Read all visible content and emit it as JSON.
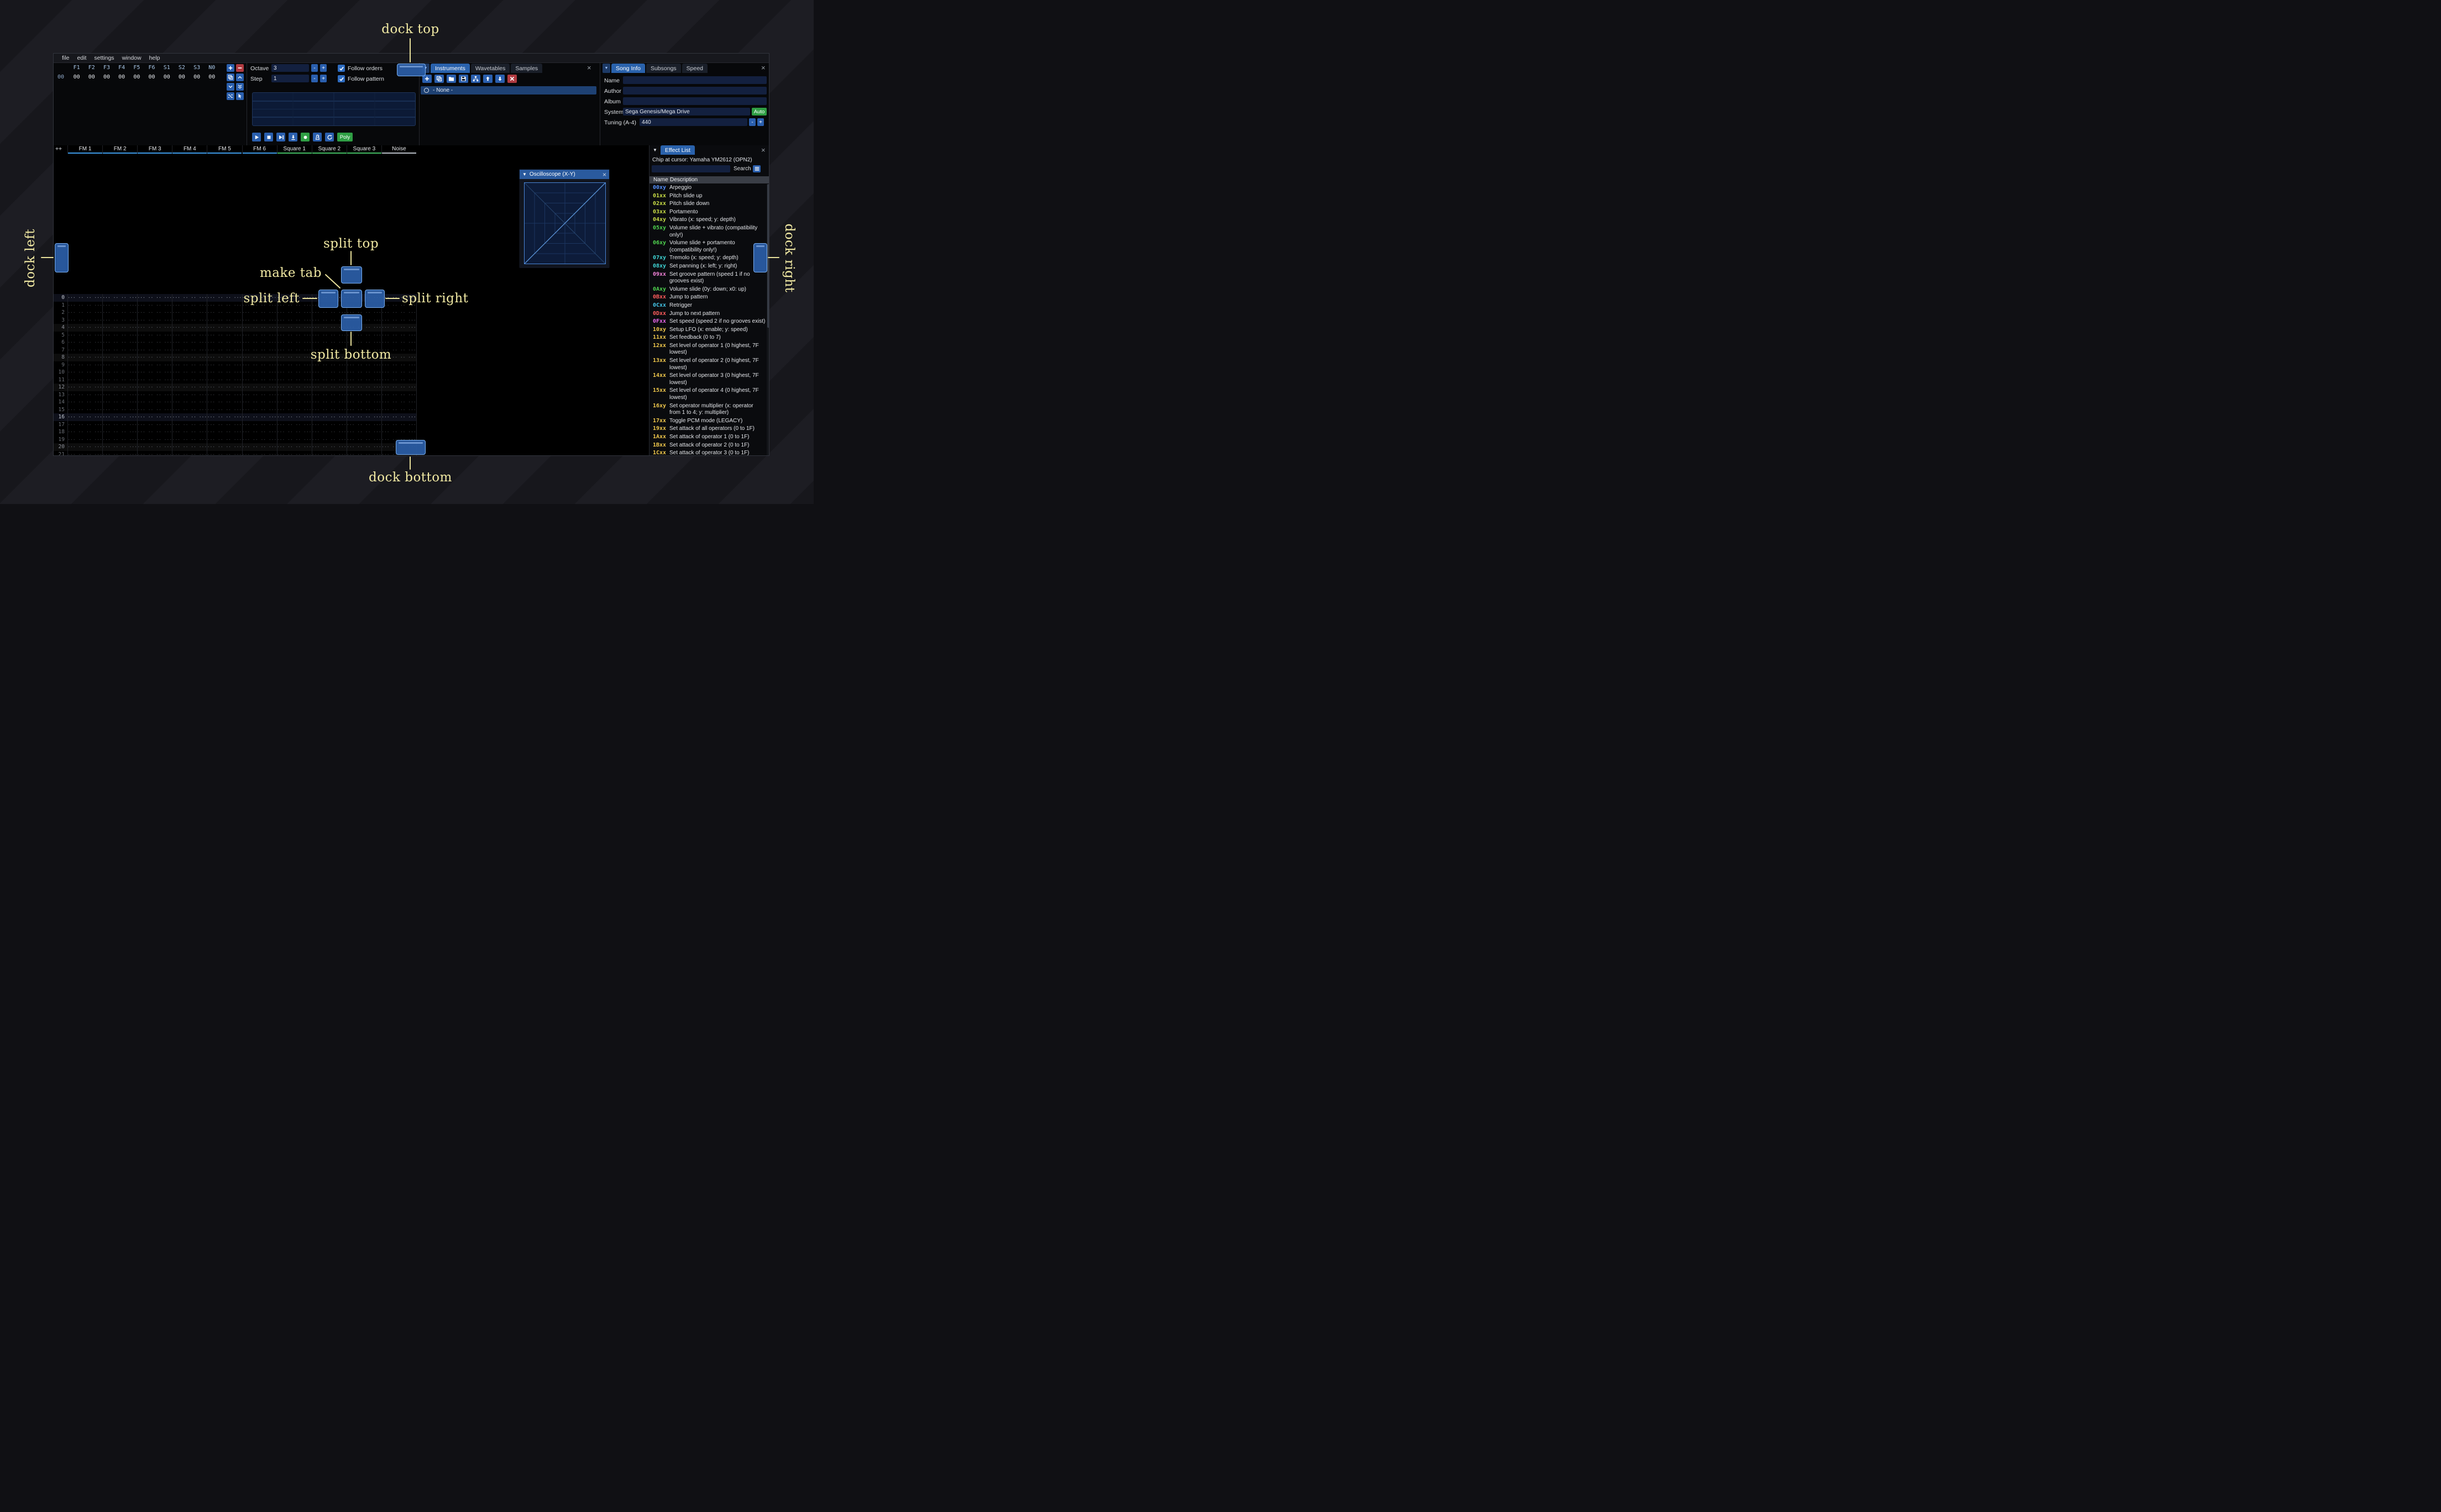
{
  "glyphs": {
    "close": "×",
    "collapse": "▼",
    "minus": "-",
    "plus": "+"
  },
  "window": {
    "menu": [
      "file",
      "edit",
      "settings",
      "window",
      "help"
    ]
  },
  "orders": {
    "row_index": "00",
    "channels": [
      "F1",
      "F2",
      "F3",
      "F4",
      "F5",
      "F6",
      "S1",
      "S2",
      "S3",
      "N0"
    ],
    "values": [
      "00",
      "00",
      "00",
      "00",
      "00",
      "00",
      "00",
      "00",
      "00",
      "00"
    ],
    "buttons": [
      {
        "name": "add-order",
        "icon": "plus",
        "variant": "blue"
      },
      {
        "name": "remove-order",
        "icon": "minus",
        "variant": "red"
      },
      {
        "name": "duplicate-order",
        "icon": "copy",
        "variant": "blue"
      },
      {
        "name": "move-order-up",
        "icon": "chevron-up",
        "variant": "blue"
      },
      {
        "name": "move-order-down",
        "icon": "chevron-down",
        "variant": "blue"
      },
      {
        "name": "duplicate-order-end",
        "icon": "chevrons-down",
        "variant": "blue"
      },
      {
        "name": "order-change-all",
        "icon": "shuffle",
        "variant": "blue"
      },
      {
        "name": "order-edit-mode",
        "icon": "cursor",
        "variant": "blue"
      }
    ]
  },
  "transport": {
    "octave_label": "Octave",
    "octave_value": "3",
    "step_label": "Step",
    "step_value": "1",
    "follow_orders_label": "Follow orders",
    "follow_pattern_label": "Follow pattern",
    "poly_label": "Poly",
    "buttons": [
      {
        "name": "play",
        "icon": "play",
        "variant": "blue"
      },
      {
        "name": "stop",
        "icon": "stop",
        "variant": "blue"
      },
      {
        "name": "play-pattern",
        "icon": "play-pattern",
        "variant": "blue"
      },
      {
        "name": "step-row",
        "icon": "step",
        "variant": "blue"
      },
      {
        "name": "record",
        "icon": "record",
        "variant": "green"
      },
      {
        "name": "metronome",
        "icon": "metronome",
        "variant": "blue"
      },
      {
        "name": "repeat-pattern",
        "icon": "repeat",
        "variant": "blue"
      }
    ]
  },
  "instruments": {
    "tabs": [
      "Instruments",
      "Wavetables",
      "Samples"
    ],
    "active_tab": "Instruments",
    "toolbar": [
      {
        "name": "add-instrument",
        "icon": "plus",
        "variant": "blue"
      },
      {
        "name": "duplicate-instrument",
        "icon": "copy",
        "variant": "blue"
      },
      {
        "name": "open-instrument",
        "icon": "folder",
        "variant": "blue"
      },
      {
        "name": "save-instrument",
        "icon": "floppy",
        "variant": "blue"
      },
      {
        "name": "instrument-organizer",
        "icon": "sitemap",
        "variant": "blue"
      },
      {
        "name": "move-instrument-up",
        "icon": "arrow-up",
        "variant": "blue"
      },
      {
        "name": "move-instrument-down",
        "icon": "arrow-down",
        "variant": "blue"
      },
      {
        "name": "delete-instrument",
        "icon": "x",
        "variant": "red"
      }
    ],
    "list": [
      {
        "label": "- None -",
        "selected": true
      }
    ]
  },
  "song_info": {
    "tabs": [
      "Song Info",
      "Subsongs",
      "Speed"
    ],
    "active_tab": "Song Info",
    "fields": [
      {
        "label": "Name",
        "value": ""
      },
      {
        "label": "Author",
        "value": ""
      },
      {
        "label": "Album",
        "value": ""
      }
    ],
    "system_label": "System",
    "system_value": "Sega Genesis/Mega Drive",
    "auto_label": "Auto",
    "tuning_label": "Tuning (A-4)",
    "tuning_value": "440"
  },
  "pattern": {
    "corner_label": "++",
    "empty_cell": "··· ·· ·· ···",
    "channels": [
      {
        "name": "FM 1",
        "color": "#3d9ae8"
      },
      {
        "name": "FM 2",
        "color": "#3d9ae8"
      },
      {
        "name": "FM 3",
        "color": "#3d9ae8"
      },
      {
        "name": "FM 4",
        "color": "#3d9ae8"
      },
      {
        "name": "FM 5",
        "color": "#3d9ae8"
      },
      {
        "name": "FM 6",
        "color": "#3d9ae8"
      },
      {
        "name": "Square 1",
        "color": "#43bb62"
      },
      {
        "name": "Square 2",
        "color": "#43bb62"
      },
      {
        "name": "Square 3",
        "color": "#43bb62"
      },
      {
        "name": "Noise",
        "color": "#b8bec6"
      }
    ],
    "row_numbers": [
      0,
      1,
      2,
      3,
      4,
      5,
      6,
      7,
      8,
      9,
      10,
      11,
      12,
      13,
      14,
      15,
      16,
      17,
      18,
      19,
      20,
      21
    ],
    "hl1_rows": [
      4,
      8,
      12,
      20
    ],
    "hl2_rows": [
      0,
      16
    ]
  },
  "oscilloscope": {
    "title": "Oscilloscope (X-Y)"
  },
  "effect_list": {
    "title": "Effect List",
    "chip_label": "Chip at cursor: Yamaha YM2612 (OPN2)",
    "search_label": "Search",
    "search_value": "",
    "columns": [
      "Name",
      "Description"
    ],
    "effects": [
      {
        "code": "00xy",
        "color": "#5591ff",
        "desc": "Arpeggio"
      },
      {
        "code": "01xx",
        "color": "#c8dc46",
        "desc": "Pitch slide up"
      },
      {
        "code": "02xx",
        "color": "#c8dc46",
        "desc": "Pitch slide down"
      },
      {
        "code": "03xx",
        "color": "#c8dc46",
        "desc": "Portamento"
      },
      {
        "code": "04xy",
        "color": "#c8dc46",
        "desc": "Vibrato (x: speed; y: depth)"
      },
      {
        "code": "05xy",
        "color": "#4fd24f",
        "desc": "Volume slide + vibrato (compatibility only!)"
      },
      {
        "code": "06xy",
        "color": "#4fd24f",
        "desc": "Volume slide + portamento (compatibility only!)"
      },
      {
        "code": "07xy",
        "color": "#3fd4d4",
        "desc": "Tremolo (x: speed; y: depth)"
      },
      {
        "code": "08xy",
        "color": "#3fd4d4",
        "desc": "Set panning (x: left; y: right)"
      },
      {
        "code": "09xx",
        "color": "#f282d8",
        "desc": "Set groove pattern (speed 1 if no grooves exist)"
      },
      {
        "code": "0Axy",
        "color": "#4fd24f",
        "desc": "Volume slide (0y: down; x0: up)"
      },
      {
        "code": "0Bxx",
        "color": "#ff5c5c",
        "desc": "Jump to pattern"
      },
      {
        "code": "0Cxx",
        "color": "#45c6e8",
        "desc": "Retrigger"
      },
      {
        "code": "0Dxx",
        "color": "#ff5c5c",
        "desc": "Jump to next pattern"
      },
      {
        "code": "0Fxx",
        "color": "#e866e8",
        "desc": "Set speed (speed 2 if no grooves exist)"
      },
      {
        "code": "10xy",
        "color": "#f0c84c",
        "desc": "Setup LFO (x: enable; y: speed)"
      },
      {
        "code": "11xx",
        "color": "#f0c84c",
        "desc": "Set feedback (0 to 7)"
      },
      {
        "code": "12xx",
        "color": "#f0c84c",
        "desc": "Set level of operator 1 (0 highest, 7F lowest)"
      },
      {
        "code": "13xx",
        "color": "#f0c84c",
        "desc": "Set level of operator 2 (0 highest, 7F lowest)"
      },
      {
        "code": "14xx",
        "color": "#f0c84c",
        "desc": "Set level of operator 3 (0 highest, 7F lowest)"
      },
      {
        "code": "15xx",
        "color": "#f0c84c",
        "desc": "Set level of operator 4 (0 highest, 7F lowest)"
      },
      {
        "code": "16xy",
        "color": "#f0c84c",
        "desc": "Set operator multiplier (x: operator from 1 to 4; y: multiplier)"
      },
      {
        "code": "17xx",
        "color": "#f0c84c",
        "desc": "Toggle PCM mode (LEGACY)"
      },
      {
        "code": "19xx",
        "color": "#f0c84c",
        "desc": "Set attack of all operators (0 to 1F)"
      },
      {
        "code": "1Axx",
        "color": "#f0c84c",
        "desc": "Set attack of operator 1 (0 to 1F)"
      },
      {
        "code": "1Bxx",
        "color": "#f0c84c",
        "desc": "Set attack of operator 2 (0 to 1F)"
      },
      {
        "code": "1Cxx",
        "color": "#f0c84c",
        "desc": "Set attack of operator 3 (0 to 1F)"
      }
    ]
  },
  "overlay": {
    "dock_top": "dock top",
    "dock_left": "dock left",
    "dock_right": "dock right",
    "dock_bottom": "dock bottom",
    "split_top": "split top",
    "split_left": "split left",
    "split_right": "split right",
    "split_bottom": "split bottom",
    "make_tab": "make tab"
  },
  "colors": {
    "accent": "#2a62ac",
    "dock_button": "#2b5ea7",
    "annotation": "#f1e9a3",
    "green": "#2f9e44",
    "red": "#b03a40"
  }
}
